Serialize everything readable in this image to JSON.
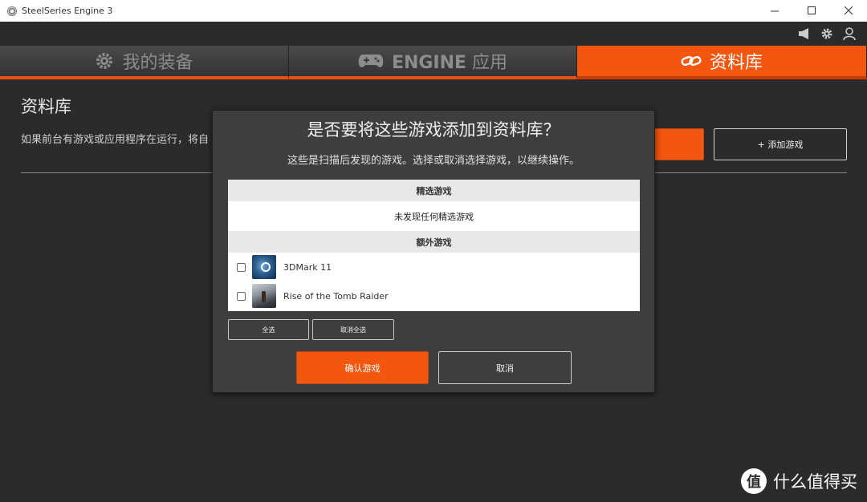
{
  "window": {
    "title": "SteelSeries Engine 3"
  },
  "tabs": [
    {
      "label": "我的装备"
    },
    {
      "prefix": "ENGINE",
      "label": " 应用"
    },
    {
      "label": "资料库"
    }
  ],
  "page": {
    "title": "资料库",
    "description": "如果前台有游戏或应用程序在运行，将自",
    "add_game_label": "+ 添加游戏"
  },
  "modal": {
    "title": "是否要将这些游戏添加到资料库？",
    "subtitle": "这些是扫描后发现的游戏。选择或取消选择游戏，以继续操作。",
    "featured_header": "精选游戏",
    "featured_empty": "未发现任何精选游戏",
    "extra_header": "额外游戏",
    "games": [
      {
        "name": "3DMark 11",
        "icon": "steam-icon",
        "checked": false
      },
      {
        "name": "Rise of the Tomb Raider",
        "icon": "tomb-raider-thumbnail",
        "checked": false
      }
    ],
    "select_all_label": "全选",
    "deselect_all_label": "取消全选",
    "confirm_label": "确认游戏",
    "cancel_label": "取消"
  },
  "watermark": {
    "text": "什么值得买",
    "logo": "值"
  },
  "colors": {
    "accent": "#f3560f",
    "background": "#2b2b2b",
    "modal": "#3e3e3e"
  }
}
